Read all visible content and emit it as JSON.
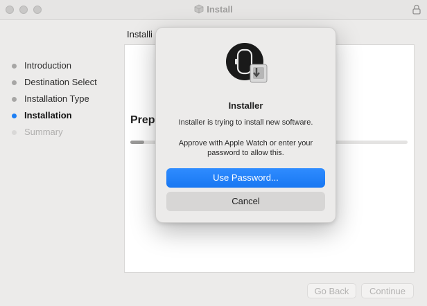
{
  "window": {
    "title": "Install",
    "title_icon": "package-icon",
    "lock_icon": "lock-icon"
  },
  "sidebar": {
    "steps": [
      {
        "label": "Introduction",
        "state": "done"
      },
      {
        "label": "Destination Select",
        "state": "done"
      },
      {
        "label": "Installation Type",
        "state": "done"
      },
      {
        "label": "Installation",
        "state": "active"
      },
      {
        "label": "Summary",
        "state": "pending"
      }
    ]
  },
  "main": {
    "heading": "Installi",
    "status": "Prep",
    "progress": 0.01
  },
  "footer": {
    "back_label": "Go Back",
    "continue_label": "Continue"
  },
  "dialog": {
    "icon": "installer-apple-watch-icon",
    "title": "Installer",
    "message": "Installer is trying to install new software.",
    "hint_line1": "Approve with Apple Watch or enter your",
    "hint_line2": "password to allow this.",
    "primary_label": "Use Password...",
    "cancel_label": "Cancel"
  },
  "colors": {
    "accent": "#1877f2",
    "window_bg": "#ecebea",
    "pending_text": "#b0afae"
  }
}
